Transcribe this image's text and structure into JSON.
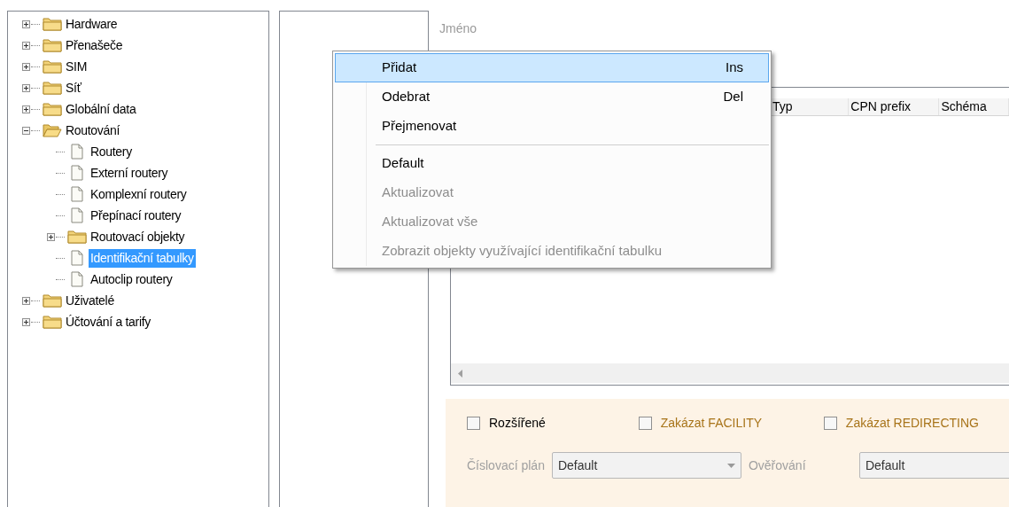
{
  "tree": [
    {
      "label": "Hardware",
      "kind": "folder",
      "expanded": false,
      "selected": false
    },
    {
      "label": "Přenašeče",
      "kind": "folder",
      "expanded": false,
      "selected": false
    },
    {
      "label": "SIM",
      "kind": "folder",
      "expanded": false,
      "selected": false
    },
    {
      "label": "Síť",
      "kind": "folder",
      "expanded": false,
      "selected": false
    },
    {
      "label": "Globální data",
      "kind": "folder",
      "expanded": false,
      "selected": false
    },
    {
      "label": "Routování",
      "kind": "folder",
      "expanded": true,
      "selected": false,
      "children": [
        {
          "label": "Routery",
          "kind": "document",
          "selected": false
        },
        {
          "label": "Externí routery",
          "kind": "document",
          "selected": false
        },
        {
          "label": "Komplexní routery",
          "kind": "document",
          "selected": false
        },
        {
          "label": "Přepínací routery",
          "kind": "document",
          "selected": false
        },
        {
          "label": "Routovací objekty",
          "kind": "folder",
          "expanded": false,
          "selected": false
        },
        {
          "label": "Identifikační tabulky",
          "kind": "document",
          "selected": true
        },
        {
          "label": "Autoclip routery",
          "kind": "document",
          "selected": false
        }
      ]
    },
    {
      "label": "Uživatelé",
      "kind": "folder",
      "expanded": false,
      "selected": false
    },
    {
      "label": "Účtování a tarify",
      "kind": "folder",
      "expanded": false,
      "selected": false
    }
  ],
  "name_label": "Jméno",
  "table": {
    "columns": [
      "Typ",
      "CPN prefix",
      "Schéma"
    ]
  },
  "options": [
    {
      "label": "Rozšířené",
      "checked": false,
      "color": "#000000"
    },
    {
      "label": "Zakázat FACILITY",
      "checked": false,
      "color": "#a8741a"
    },
    {
      "label": "Zakázat REDIRECTING",
      "checked": false,
      "color": "#a8741a"
    }
  ],
  "fields": [
    {
      "label": "Číslovací plán",
      "value": "Default",
      "disabled": true
    },
    {
      "label": "Ověřování",
      "value": "Default",
      "disabled": true
    }
  ],
  "context_menu": [
    {
      "kind": "item",
      "label": "Přidat",
      "shortcut": "Ins",
      "disabled": false,
      "selected": true
    },
    {
      "kind": "item",
      "label": "Odebrat",
      "shortcut": "Del",
      "disabled": false,
      "selected": false
    },
    {
      "kind": "item",
      "label": "Přejmenovat",
      "disabled": false,
      "selected": false
    },
    {
      "kind": "separator"
    },
    {
      "kind": "item",
      "label": "Default",
      "disabled": false,
      "selected": false
    },
    {
      "kind": "item",
      "label": "Aktualizovat",
      "disabled": true,
      "selected": false
    },
    {
      "kind": "item",
      "label": "Aktualizovat vše",
      "disabled": true,
      "selected": false
    },
    {
      "kind": "item",
      "label": "Zobrazit objekty využívající identifikační tabulku",
      "disabled": true,
      "selected": false
    }
  ]
}
